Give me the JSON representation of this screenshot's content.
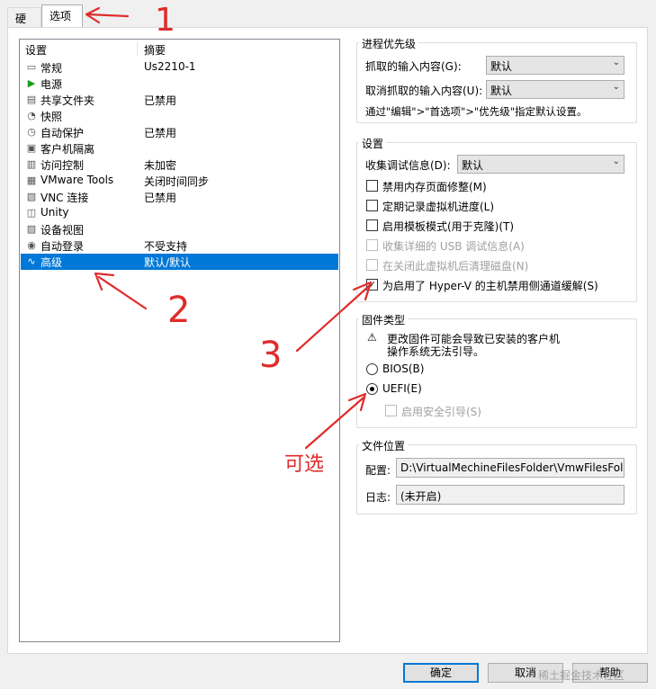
{
  "tabs": [
    "硬件",
    "选项"
  ],
  "list": {
    "header_setting": "设置",
    "header_summary": "摘要",
    "items": [
      {
        "name": "常规",
        "summary": "Us2210-1",
        "icon": "general-icon"
      },
      {
        "name": "电源",
        "summary": "",
        "icon": "power-icon"
      },
      {
        "name": "共享文件夹",
        "summary": "已禁用",
        "icon": "shared-folder-icon"
      },
      {
        "name": "快照",
        "summary": "",
        "icon": "snapshot-icon"
      },
      {
        "name": "自动保护",
        "summary": "已禁用",
        "icon": "autoprotect-icon"
      },
      {
        "name": "客户机隔离",
        "summary": "",
        "icon": "isolation-icon"
      },
      {
        "name": "访问控制",
        "summary": "未加密",
        "icon": "lock-icon"
      },
      {
        "name": "VMware Tools",
        "summary": "关闭时间同步",
        "icon": "vmware-tools-icon"
      },
      {
        "name": "VNC 连接",
        "summary": "已禁用",
        "icon": "vnc-icon"
      },
      {
        "name": "Unity",
        "summary": "",
        "icon": "unity-icon"
      },
      {
        "name": "设备视图",
        "summary": "",
        "icon": "device-view-icon"
      },
      {
        "name": "自动登录",
        "summary": "不受支持",
        "icon": "autologin-icon"
      },
      {
        "name": "高级",
        "summary": "默认/默认",
        "icon": "advanced-icon"
      }
    ]
  },
  "priority": {
    "title": "进程优先级",
    "grabbed_label": "抓取的输入内容(G):",
    "grabbed_value": "默认",
    "ungrabbed_label": "取消抓取的输入内容(U):",
    "ungrabbed_value": "默认",
    "note": "通过\"编辑\">\"首选项\">\"优先级\"指定默认设置。"
  },
  "settings": {
    "title": "设置",
    "debug_label": "收集调试信息(D):",
    "debug_value": "默认",
    "options": [
      {
        "label": "禁用内存页面修整(M)",
        "checked": false,
        "disabled": false
      },
      {
        "label": "定期记录虚拟机进度(L)",
        "checked": false,
        "disabled": false
      },
      {
        "label": "启用模板模式(用于克隆)(T)",
        "checked": false,
        "disabled": false
      },
      {
        "label": "收集详细的 USB 调试信息(A)",
        "checked": false,
        "disabled": true
      },
      {
        "label": "在关闭此虚拟机后清理磁盘(N)",
        "checked": false,
        "disabled": true
      },
      {
        "label": "为启用了 Hyper-V 的主机禁用侧通道缓解(S)",
        "checked": true,
        "disabled": false
      }
    ]
  },
  "firmware": {
    "title": "固件类型",
    "warning_line1": "更改固件可能会导致已安装的客户机",
    "warning_line2": "操作系统无法引导。",
    "bios_label": "BIOS(B)",
    "uefi_label": "UEFI(E)",
    "selected": "UEFI",
    "secure_boot_label": "启用安全引导(S)"
  },
  "file_location": {
    "title": "文件位置",
    "config_label": "配置:",
    "config_value": "D:\\VirtualMechineFilesFolder\\VmwFilesFolder\\U",
    "log_label": "日志:",
    "log_value": "(未开启)"
  },
  "buttons": {
    "ok": "确定",
    "cancel": "取消",
    "help": "帮助"
  },
  "annotations": {
    "n1": "1",
    "n2": "2",
    "n3": "3",
    "optional": "可选"
  },
  "watermark": "稀土掘金技术社区",
  "colors": {
    "selection": "#0078d7",
    "annotation": "#e02b2b"
  }
}
